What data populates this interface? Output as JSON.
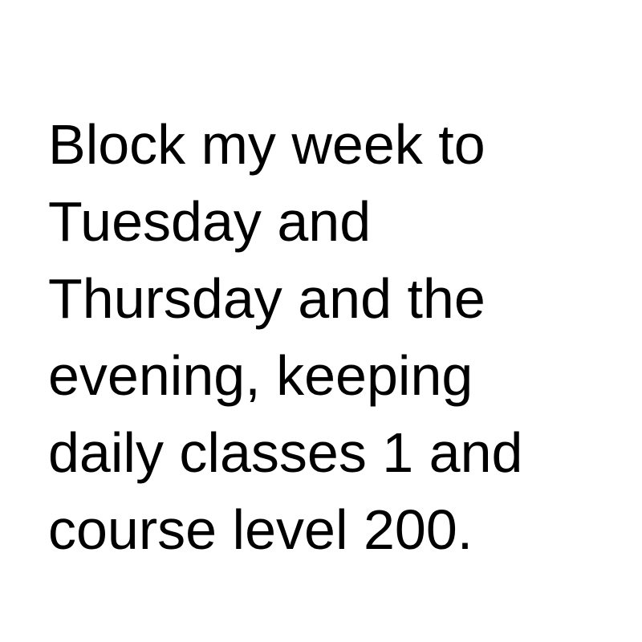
{
  "message": {
    "lines": [
      "Block my week to",
      "Tuesday and",
      "Thursday and the",
      "evening, keeping",
      "daily classes 1 and",
      "course level 200."
    ]
  },
  "colors": {
    "background": "#ffffff",
    "text": "#000000"
  }
}
